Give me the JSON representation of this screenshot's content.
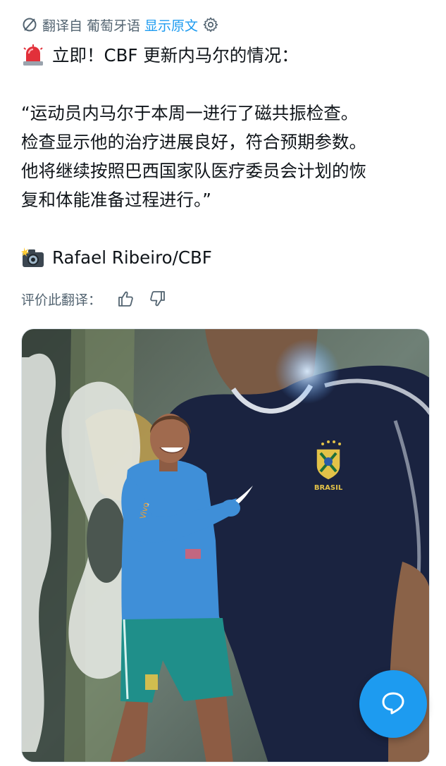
{
  "translation_bar": {
    "prefix": "翻译自",
    "language": "葡萄牙语",
    "show_original": "显示原文"
  },
  "post": {
    "headline": "立即！CBF 更新内马尔的情况：",
    "quote_lines": [
      "“运动员内马尔于本周一进行了磁共振检查。",
      "检查显示他的治疗进展良好，符合预期参数。",
      "他将继续按照巴西国家队医疗委员会计划的恢",
      "复和体能准备过程进行。”"
    ],
    "credit": "Rafael Ribeiro/CBF"
  },
  "rating": {
    "label": "评价此翻译："
  },
  "photo_text": {
    "jersey_text": "BRASIL"
  },
  "colors": {
    "accent": "#1d9bf0",
    "muted": "#536471",
    "jersey_navy": "#1a2340",
    "training_top": "#3f8fd8",
    "shorts": "#1f8f8a"
  },
  "icons": {
    "translate": "no-translate-icon",
    "settings": "gear-icon",
    "alert": "siren-emoji",
    "camera": "camera-flash-emoji",
    "like": "thumbs-up-icon",
    "dislike": "thumbs-down-icon",
    "reply": "chat-bubble-icon"
  }
}
